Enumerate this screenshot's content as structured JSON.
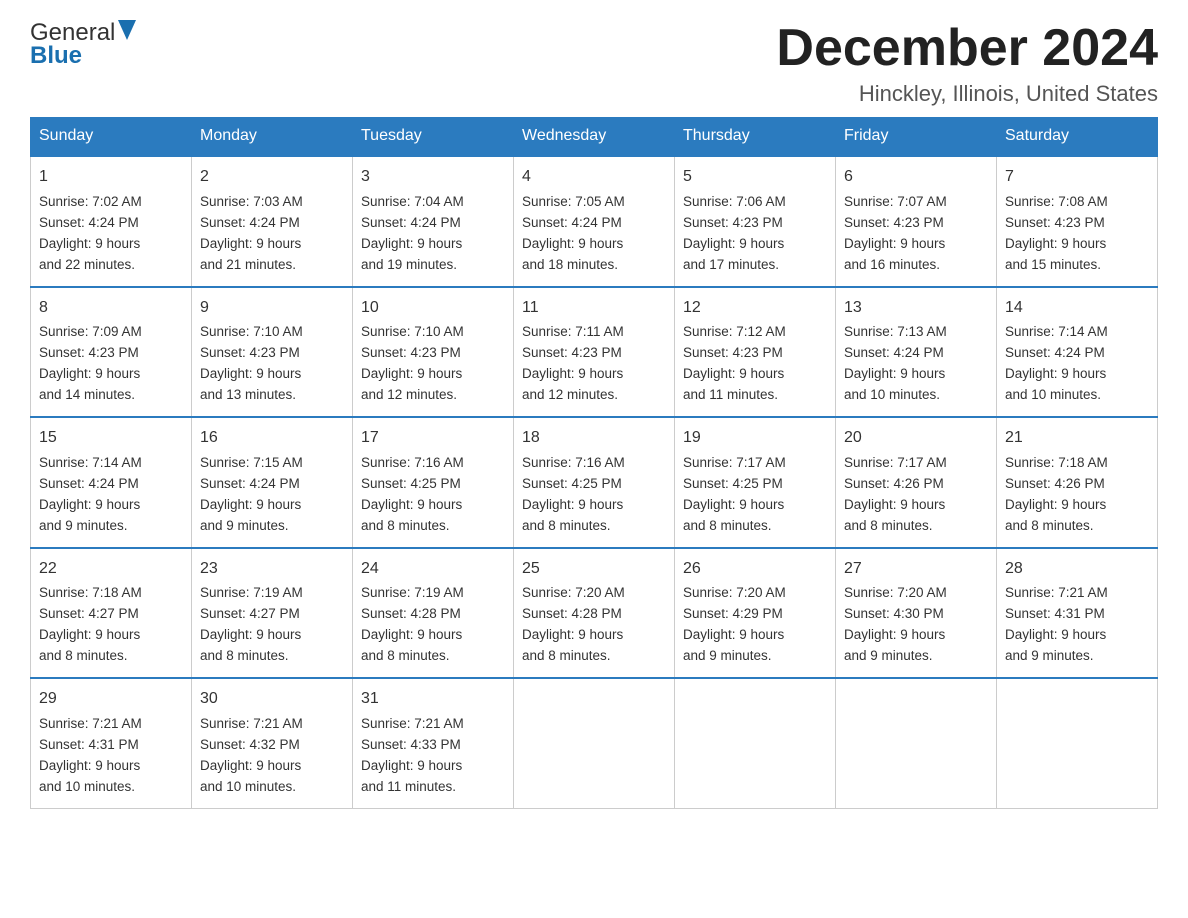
{
  "header": {
    "logo_general": "General",
    "logo_blue": "Blue",
    "month_title": "December 2024",
    "location": "Hinckley, Illinois, United States"
  },
  "calendar": {
    "days_of_week": [
      "Sunday",
      "Monday",
      "Tuesday",
      "Wednesday",
      "Thursday",
      "Friday",
      "Saturday"
    ],
    "weeks": [
      [
        {
          "day": "1",
          "sunrise": "7:02 AM",
          "sunset": "4:24 PM",
          "daylight": "9 hours and 22 minutes."
        },
        {
          "day": "2",
          "sunrise": "7:03 AM",
          "sunset": "4:24 PM",
          "daylight": "9 hours and 21 minutes."
        },
        {
          "day": "3",
          "sunrise": "7:04 AM",
          "sunset": "4:24 PM",
          "daylight": "9 hours and 19 minutes."
        },
        {
          "day": "4",
          "sunrise": "7:05 AM",
          "sunset": "4:24 PM",
          "daylight": "9 hours and 18 minutes."
        },
        {
          "day": "5",
          "sunrise": "7:06 AM",
          "sunset": "4:23 PM",
          "daylight": "9 hours and 17 minutes."
        },
        {
          "day": "6",
          "sunrise": "7:07 AM",
          "sunset": "4:23 PM",
          "daylight": "9 hours and 16 minutes."
        },
        {
          "day": "7",
          "sunrise": "7:08 AM",
          "sunset": "4:23 PM",
          "daylight": "9 hours and 15 minutes."
        }
      ],
      [
        {
          "day": "8",
          "sunrise": "7:09 AM",
          "sunset": "4:23 PM",
          "daylight": "9 hours and 14 minutes."
        },
        {
          "day": "9",
          "sunrise": "7:10 AM",
          "sunset": "4:23 PM",
          "daylight": "9 hours and 13 minutes."
        },
        {
          "day": "10",
          "sunrise": "7:10 AM",
          "sunset": "4:23 PM",
          "daylight": "9 hours and 12 minutes."
        },
        {
          "day": "11",
          "sunrise": "7:11 AM",
          "sunset": "4:23 PM",
          "daylight": "9 hours and 12 minutes."
        },
        {
          "day": "12",
          "sunrise": "7:12 AM",
          "sunset": "4:23 PM",
          "daylight": "9 hours and 11 minutes."
        },
        {
          "day": "13",
          "sunrise": "7:13 AM",
          "sunset": "4:24 PM",
          "daylight": "9 hours and 10 minutes."
        },
        {
          "day": "14",
          "sunrise": "7:14 AM",
          "sunset": "4:24 PM",
          "daylight": "9 hours and 10 minutes."
        }
      ],
      [
        {
          "day": "15",
          "sunrise": "7:14 AM",
          "sunset": "4:24 PM",
          "daylight": "9 hours and 9 minutes."
        },
        {
          "day": "16",
          "sunrise": "7:15 AM",
          "sunset": "4:24 PM",
          "daylight": "9 hours and 9 minutes."
        },
        {
          "day": "17",
          "sunrise": "7:16 AM",
          "sunset": "4:25 PM",
          "daylight": "9 hours and 8 minutes."
        },
        {
          "day": "18",
          "sunrise": "7:16 AM",
          "sunset": "4:25 PM",
          "daylight": "9 hours and 8 minutes."
        },
        {
          "day": "19",
          "sunrise": "7:17 AM",
          "sunset": "4:25 PM",
          "daylight": "9 hours and 8 minutes."
        },
        {
          "day": "20",
          "sunrise": "7:17 AM",
          "sunset": "4:26 PM",
          "daylight": "9 hours and 8 minutes."
        },
        {
          "day": "21",
          "sunrise": "7:18 AM",
          "sunset": "4:26 PM",
          "daylight": "9 hours and 8 minutes."
        }
      ],
      [
        {
          "day": "22",
          "sunrise": "7:18 AM",
          "sunset": "4:27 PM",
          "daylight": "9 hours and 8 minutes."
        },
        {
          "day": "23",
          "sunrise": "7:19 AM",
          "sunset": "4:27 PM",
          "daylight": "9 hours and 8 minutes."
        },
        {
          "day": "24",
          "sunrise": "7:19 AM",
          "sunset": "4:28 PM",
          "daylight": "9 hours and 8 minutes."
        },
        {
          "day": "25",
          "sunrise": "7:20 AM",
          "sunset": "4:28 PM",
          "daylight": "9 hours and 8 minutes."
        },
        {
          "day": "26",
          "sunrise": "7:20 AM",
          "sunset": "4:29 PM",
          "daylight": "9 hours and 9 minutes."
        },
        {
          "day": "27",
          "sunrise": "7:20 AM",
          "sunset": "4:30 PM",
          "daylight": "9 hours and 9 minutes."
        },
        {
          "day": "28",
          "sunrise": "7:21 AM",
          "sunset": "4:31 PM",
          "daylight": "9 hours and 9 minutes."
        }
      ],
      [
        {
          "day": "29",
          "sunrise": "7:21 AM",
          "sunset": "4:31 PM",
          "daylight": "9 hours and 10 minutes."
        },
        {
          "day": "30",
          "sunrise": "7:21 AM",
          "sunset": "4:32 PM",
          "daylight": "9 hours and 10 minutes."
        },
        {
          "day": "31",
          "sunrise": "7:21 AM",
          "sunset": "4:33 PM",
          "daylight": "9 hours and 11 minutes."
        },
        null,
        null,
        null,
        null
      ]
    ],
    "labels": {
      "sunrise": "Sunrise:",
      "sunset": "Sunset:",
      "daylight": "Daylight:"
    }
  }
}
